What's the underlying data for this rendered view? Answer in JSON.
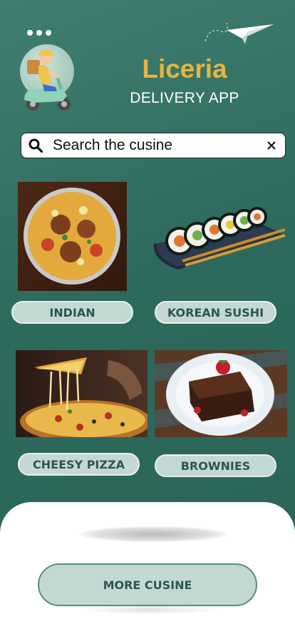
{
  "header": {
    "brand_title": "Liceria",
    "brand_subtitle": "DELIVERY APP",
    "menu_icon": "more-dots-icon",
    "mascot": "delivery-scooter-rider",
    "decoration_icon": "paper-plane-icon"
  },
  "search": {
    "placeholder": "Search the cusine",
    "value": "",
    "search_icon": "search-icon",
    "clear_icon": "close-icon"
  },
  "cuisines": [
    {
      "label": "INDIAN",
      "image": "biryani-plate"
    },
    {
      "label": "KOREAN SUSHI",
      "image": "sushi-roll-tray"
    },
    {
      "label": "CHEESY PIZZA",
      "image": "pizza-slice"
    },
    {
      "label": "BROWNIES",
      "image": "brownie-plate"
    }
  ],
  "footer": {
    "more_label": "MORE CUSINE"
  },
  "colors": {
    "background": "#2d6a5d",
    "brand": "#e9b43f",
    "button": "#c3d8d2",
    "button_text": "#2f5550"
  }
}
